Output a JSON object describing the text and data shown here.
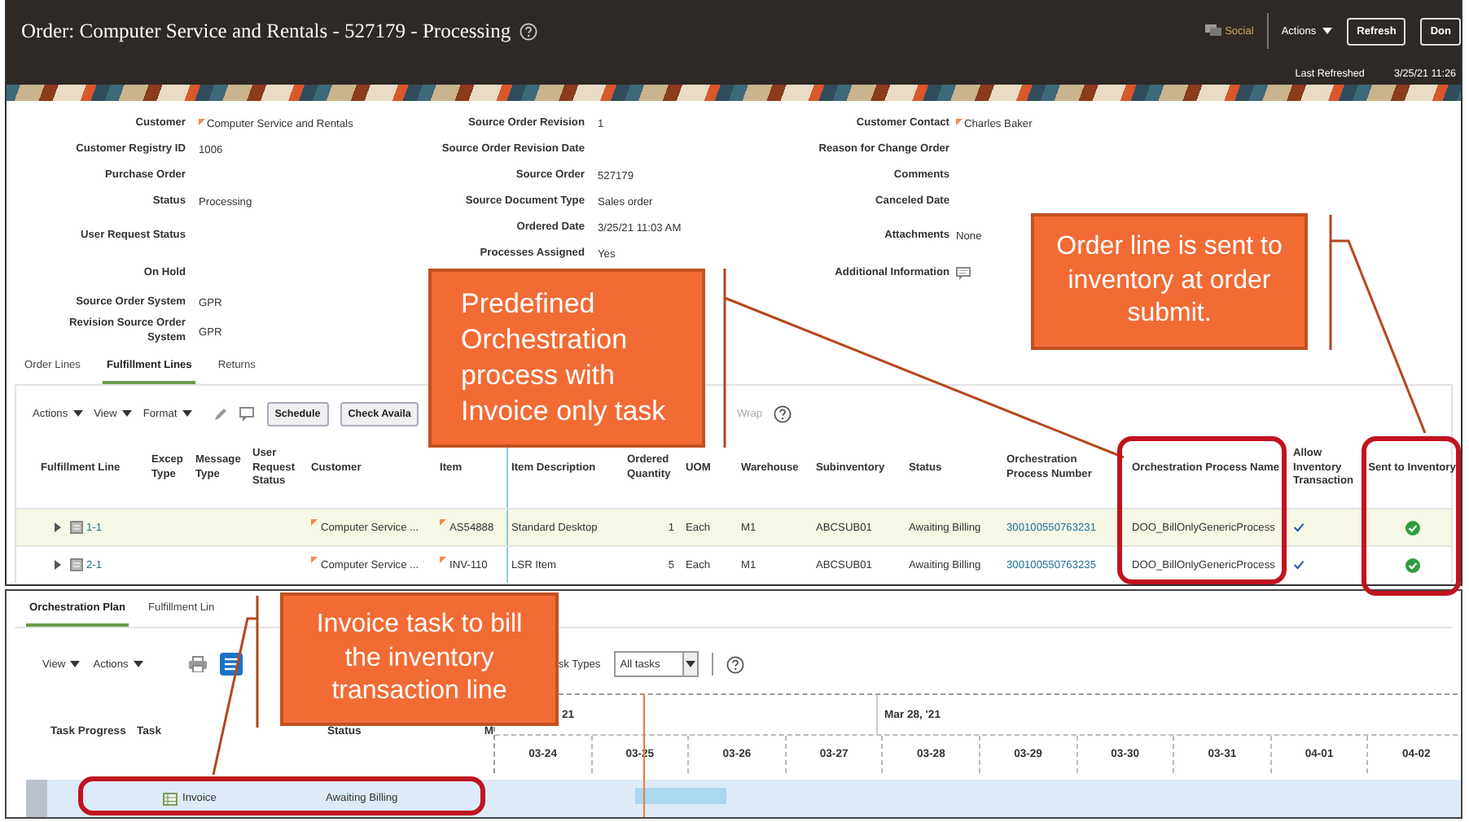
{
  "header": {
    "title": "Order: Computer Service and Rentals - 527179 - Processing",
    "social": "Social",
    "actions": "Actions",
    "refresh": "Refresh",
    "done": "Don",
    "last_refreshed_label": "Last Refreshed",
    "last_refreshed_value": "3/25/21 11:26"
  },
  "details": {
    "columns": [
      [
        {
          "label": "Customer",
          "value": "Computer Service and Rentals",
          "kind": "flagged"
        },
        {
          "label": "Customer Registry ID",
          "value": "1006",
          "kind": "text"
        },
        {
          "label": "Purchase Order",
          "kind": "text"
        },
        {
          "label": "Status",
          "value": "Processing",
          "kind": "text"
        },
        {
          "label": "User Request Status",
          "kind": "text"
        },
        {
          "label": "On Hold",
          "kind": "text"
        },
        {
          "label": "Source Order System",
          "value": "GPR",
          "kind": "text"
        },
        {
          "label": "Revision Source Order System",
          "value": "GPR",
          "kind": "text"
        }
      ],
      [
        {
          "label": "Source Order Revision",
          "value": "1",
          "kind": "text"
        },
        {
          "label": "Source Order Revision Date",
          "kind": "text"
        },
        {
          "label": "Source Order",
          "value": "527179",
          "kind": "text"
        },
        {
          "label": "Source Document Type",
          "value": "Sales order",
          "kind": "text"
        },
        {
          "label": "Ordered Date",
          "value": "3/25/21 11:03 AM",
          "kind": "text"
        },
        {
          "label": "Processes Assigned",
          "value": "Yes",
          "kind": "text"
        }
      ],
      [
        {
          "label": "Customer Contact",
          "value": "Charles Baker",
          "kind": "flagged"
        },
        {
          "label": "Reason for Change Order",
          "kind": "text"
        },
        {
          "label": "Comments",
          "kind": "text"
        },
        {
          "label": "Canceled Date",
          "kind": "text"
        },
        {
          "label": "Attachments",
          "value": "None",
          "kind": "text"
        },
        {
          "label": "Additional Information",
          "kind": "icon"
        }
      ]
    ]
  },
  "tabs": [
    {
      "label": "Order Lines",
      "selected": false
    },
    {
      "label": "Fulfillment Lines",
      "selected": true
    },
    {
      "label": "Returns",
      "selected": false
    }
  ],
  "toolbar": {
    "menus": [
      "Actions",
      "View",
      "Format"
    ],
    "buttons": [
      "Schedule",
      "Check Availa"
    ],
    "wrap": {
      "label": "Wrap",
      "disabled": true
    }
  },
  "table": {
    "columns": [
      "Fulfillment Line",
      "Excep Type",
      "Message Type",
      "User Request Status",
      "Customer",
      "Item",
      "Item Description",
      "Ordered Quantity",
      "UOM",
      "Warehouse",
      "Subinventory",
      "Status",
      "Orchestration Process Number",
      "Orchestration Process Name",
      "Allow Inventory Transaction",
      "Sent to Inventory"
    ],
    "rows": [
      {
        "selected": true,
        "expanded": false,
        "line": "1-1",
        "customer": "Computer Service ...",
        "item": "AS54888",
        "item_description": "Standard Desktop",
        "ordered_quantity": "1",
        "uom": "Each",
        "warehouse": "M1",
        "subinventory": "ABCSUB01",
        "status": "Awaiting Billing",
        "process_number": "300100550763231",
        "process_name": "DOO_BillOnlyGenericProcess",
        "allow_inventory_transaction": true,
        "sent_to_inventory": true
      },
      {
        "selected": false,
        "expanded": false,
        "line": "2-1",
        "customer": "Computer Service ...",
        "item": "INV-110",
        "item_description": "LSR Item",
        "ordered_quantity": "5",
        "uom": "Each",
        "warehouse": "M1",
        "subinventory": "ABCSUB01",
        "status": "Awaiting Billing",
        "process_number": "300100550763235",
        "process_name": "DOO_BillOnlyGenericProcess",
        "allow_inventory_transaction": true,
        "sent_to_inventory": true
      }
    ]
  },
  "plan": {
    "tabs": [
      {
        "label": "Orchestration Plan",
        "selected": true
      },
      {
        "label": "Fulfillment Lin",
        "selected": false
      }
    ],
    "toolbar": {
      "menus": [
        "View",
        "Actions"
      ],
      "task_types_label": "sk Types",
      "task_types_value": "All tasks"
    },
    "gantt": {
      "columns": [
        "Task Progress",
        "Task",
        "Status",
        "M"
      ],
      "weeks": [
        "21",
        "Mar 28, '21"
      ],
      "days": [
        "03-24",
        "03-25",
        "03-26",
        "03-27",
        "03-28",
        "03-29",
        "03-30",
        "03-31",
        "04-01",
        "04-02"
      ],
      "rows": [
        {
          "task": "Invoice",
          "status": "Awaiting Billing",
          "selected": true
        }
      ]
    }
  },
  "callouts": [
    {
      "text": "Predefined Orchestration process with Invoice only task"
    },
    {
      "text": "Order line is sent to inventory at order submit."
    },
    {
      "text": "Invoice task to bill the inventory transaction line"
    }
  ]
}
